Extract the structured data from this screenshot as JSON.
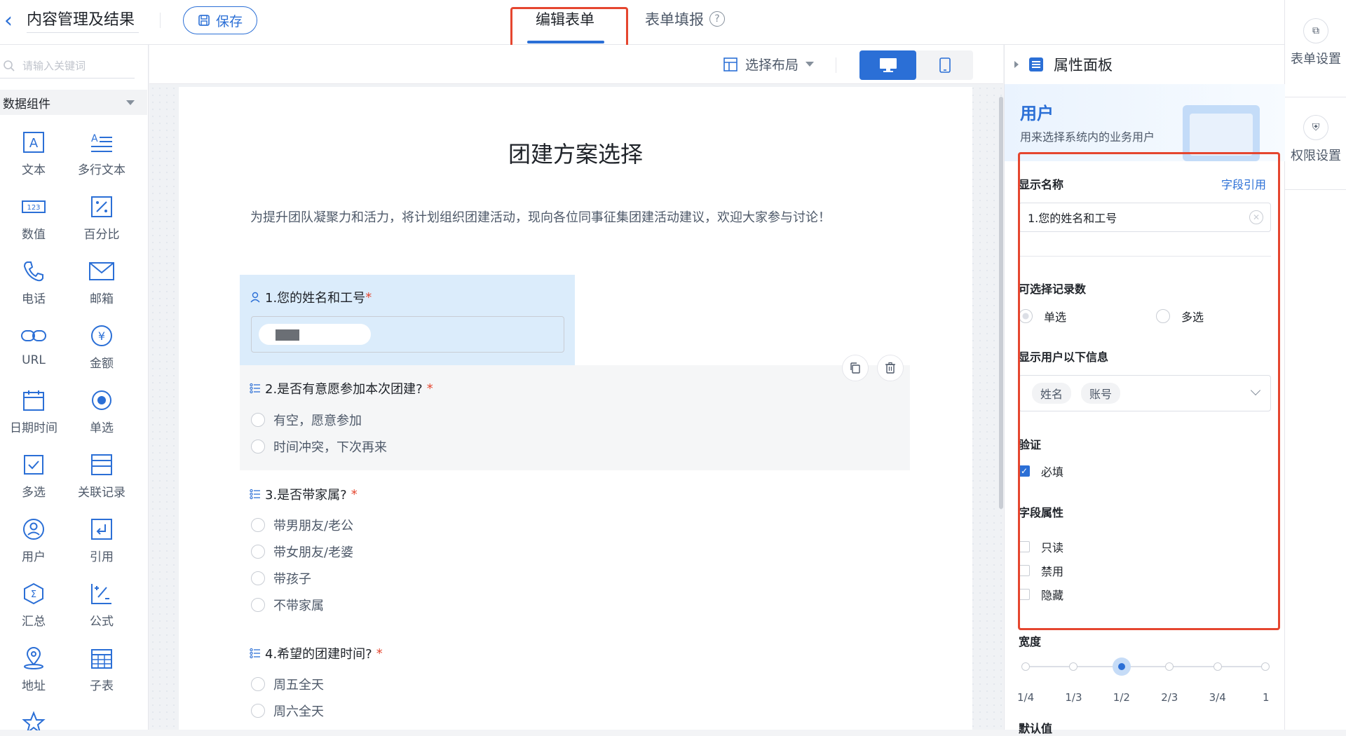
{
  "topbar": {
    "title": "内容管理及结果",
    "save_label": "保存",
    "tab_edit": "编辑表单",
    "tab_fill": "表单填报"
  },
  "rail": {
    "form_settings": "表单设置",
    "perm_settings": "权限设置"
  },
  "sidebar": {
    "search_placeholder": "请输入关键词",
    "group_label": "数据组件",
    "components": [
      {
        "label": "文本",
        "icon": "text-icon"
      },
      {
        "label": "多行文本",
        "icon": "multiline-text-icon"
      },
      {
        "label": "数值",
        "icon": "number-icon"
      },
      {
        "label": "百分比",
        "icon": "percent-icon"
      },
      {
        "label": "电话",
        "icon": "phone-icon"
      },
      {
        "label": "邮箱",
        "icon": "mail-icon"
      },
      {
        "label": "URL",
        "icon": "link-icon"
      },
      {
        "label": "金额",
        "icon": "currency-icon"
      },
      {
        "label": "日期时间",
        "icon": "calendar-icon"
      },
      {
        "label": "单选",
        "icon": "radio-icon"
      },
      {
        "label": "多选",
        "icon": "checkbox-icon"
      },
      {
        "label": "关联记录",
        "icon": "relation-icon"
      },
      {
        "label": "用户",
        "icon": "user-icon"
      },
      {
        "label": "引用",
        "icon": "reference-icon"
      },
      {
        "label": "汇总",
        "icon": "sum-icon"
      },
      {
        "label": "公式",
        "icon": "formula-icon"
      },
      {
        "label": "地址",
        "icon": "location-icon"
      },
      {
        "label": "子表",
        "icon": "subtable-icon"
      }
    ]
  },
  "toolbar": {
    "layout_label": "选择布局"
  },
  "form": {
    "title": "团建方案选择",
    "description": "为提升团队凝聚力和活力，将计划组织团建活动，现向各位同事征集团建活动建议，欢迎大家参与讨论！",
    "q1": {
      "label": "1.您的姓名和工号",
      "required": "*"
    },
    "q2": {
      "label": "2.是否有意愿参加本次团建?",
      "required": "*",
      "options": [
        "有空，愿意参加",
        "时间冲突，下次再来"
      ]
    },
    "q3": {
      "label": "3.是否带家属?",
      "required": "*",
      "options": [
        "带男朋友/老公",
        "带女朋友/老婆",
        "带孩子",
        "不带家属"
      ]
    },
    "q4": {
      "label": "4.希望的团建时间?",
      "required": "*",
      "options": [
        "周五全天",
        "周六全天"
      ]
    }
  },
  "props": {
    "panel_title": "属性面板",
    "hero_title": "用户",
    "hero_sub": "用来选择系统内的业务用户",
    "display_name_label": "显示名称",
    "field_ref_link": "字段引用",
    "display_name_value": "1.您的姓名和工号",
    "record_count_label": "可选择记录数",
    "single_label": "单选",
    "multi_label": "多选",
    "show_info_label": "显示用户以下信息",
    "tags": [
      "姓名",
      "账号"
    ],
    "validation_label": "验证",
    "required_label": "必填",
    "field_attr_label": "字段属性",
    "readonly_label": "只读",
    "disabled_label": "禁用",
    "hidden_label": "隐藏",
    "width_label": "宽度",
    "width_options": [
      "1/4",
      "1/3",
      "1/2",
      "2/3",
      "3/4",
      "1"
    ],
    "width_selected": "1/2",
    "default_label": "默认值"
  }
}
